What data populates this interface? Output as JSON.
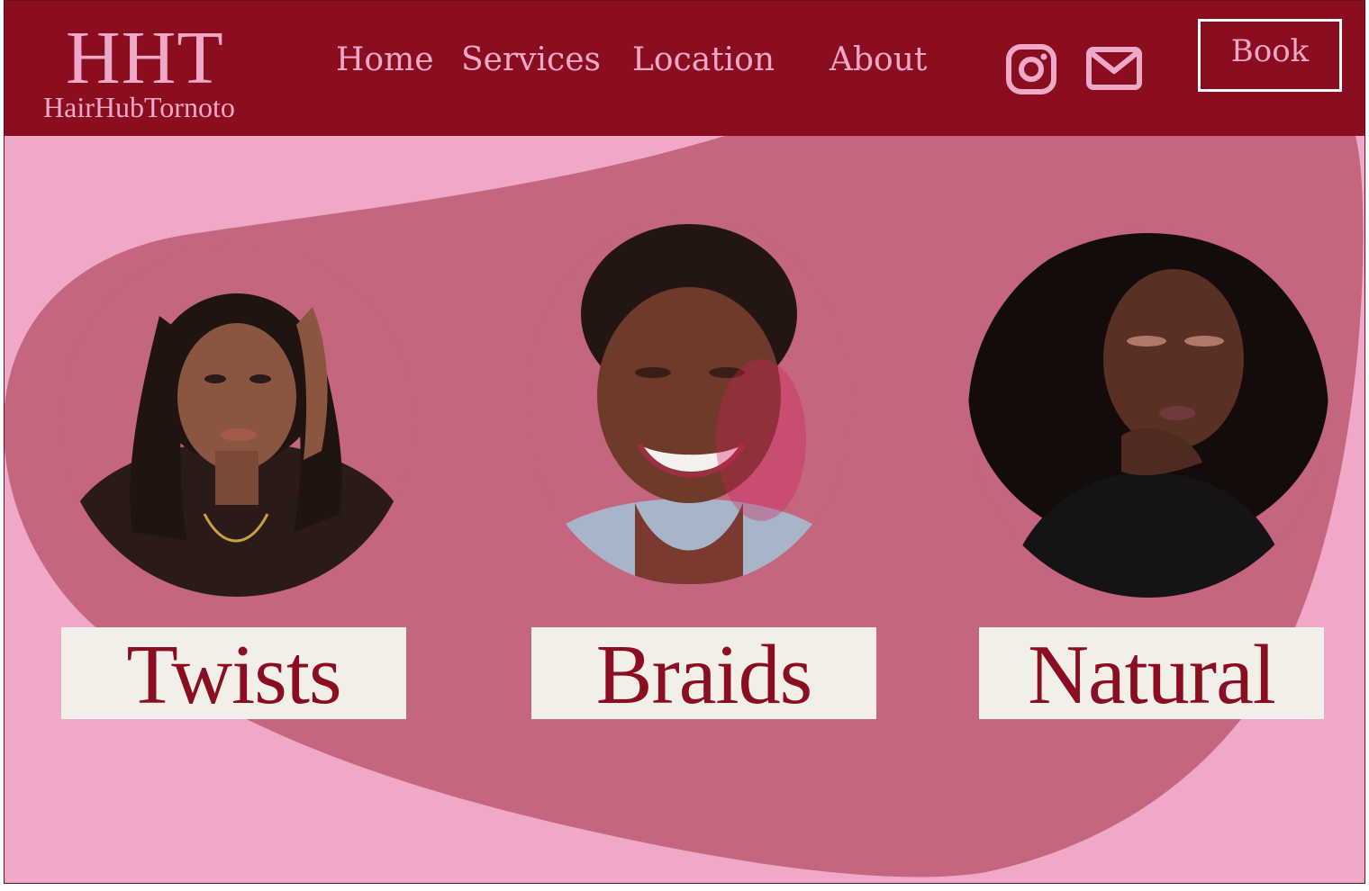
{
  "brand": {
    "mark": "HHT",
    "name": "HairHubTornoto"
  },
  "nav": {
    "items": [
      {
        "label": "Home"
      },
      {
        "label": "Services"
      },
      {
        "label": "Location"
      },
      {
        "label": "About"
      }
    ]
  },
  "social": {
    "instagram_icon": "instagram-icon",
    "mail_icon": "mail-icon"
  },
  "cta": {
    "book_label": "Book"
  },
  "services": [
    {
      "label": "Twists"
    },
    {
      "label": "Braids"
    },
    {
      "label": "Natural"
    }
  ],
  "colors": {
    "header": "#8a0e1f",
    "pink_light": "#f0a8c8",
    "blob": "#c3667e",
    "label_bg": "#f1efe8",
    "label_text": "#8a0e1f"
  }
}
